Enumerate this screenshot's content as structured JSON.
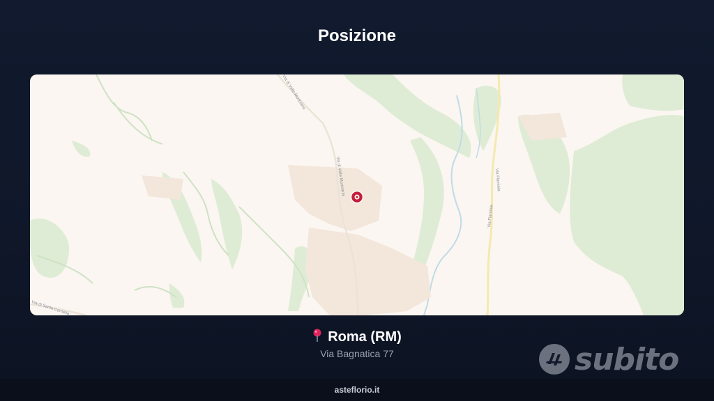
{
  "header": {
    "title": "Posizione"
  },
  "map": {
    "road_labels": [
      "Via di Valle Muriciana",
      "Via di Valle Muriciana",
      "Via Flaminia",
      "Via Flaminia",
      "Via di Santa Cornelia"
    ],
    "marker_icon": "map-marker-icon"
  },
  "location": {
    "city": "Roma (RM)",
    "address": "Via Bagnatica 77",
    "pin_icon": "pin-icon"
  },
  "brand": {
    "name": "subito",
    "icon": "subito-logo-icon"
  },
  "footer": {
    "site": "asteflorio.it"
  }
}
